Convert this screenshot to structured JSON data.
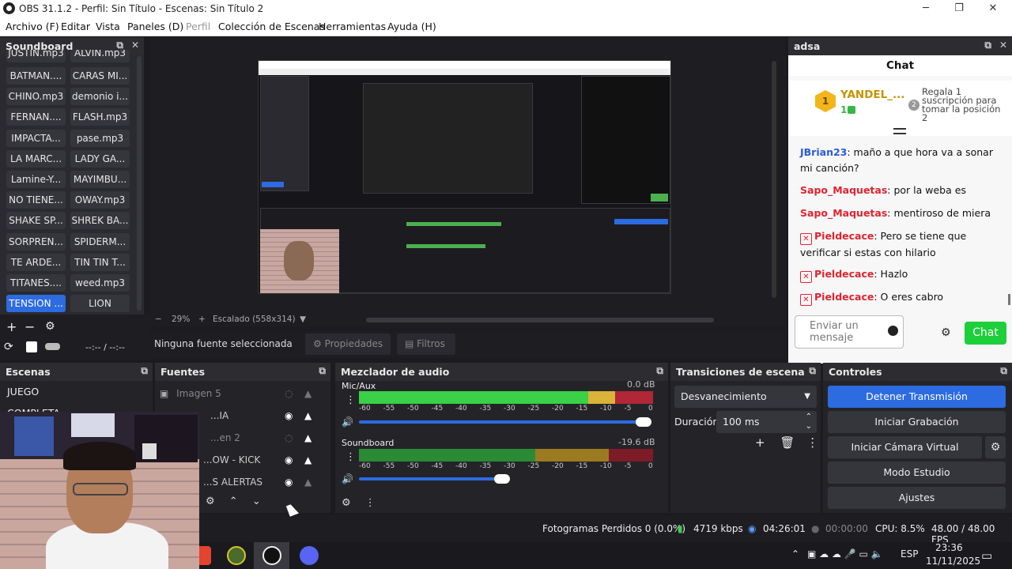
{
  "window": {
    "title": "OBS 31.1.2 - Perfil: Sin Título - Escenas: Sin Título 2",
    "min": "─",
    "max": "❐",
    "close": "✕"
  },
  "menu": {
    "items": [
      "Archivo (F)",
      "Editar",
      "Vista",
      "Paneles (D)",
      "Perfil",
      "Colección de Escenas",
      "Herramientas",
      "Ayuda (H)"
    ]
  },
  "soundboard": {
    "title": "Soundboard",
    "top_partial": [
      "JUSTIN.mp3",
      "ALVIN.mp3"
    ],
    "buttons": [
      [
        "BATMAN....",
        "CARAS MI..."
      ],
      [
        "CHINO.mp3",
        "demonio i..."
      ],
      [
        "FERNAN....",
        "FLASH.mp3"
      ],
      [
        "IMPACTA...",
        "pase.mp3"
      ],
      [
        "LA MARC...",
        "LADY GA..."
      ],
      [
        "Lamine-Y...",
        "MAYIMBU..."
      ],
      [
        "NO TIENE...",
        "OWAY.mp3"
      ],
      [
        "SHAKE SP...",
        "SHREK BA..."
      ],
      [
        "SORPREN...",
        "SPIDERM..."
      ],
      [
        "TE ARDE...",
        "TIN TIN T..."
      ],
      [
        "TITANES....",
        "weed.mp3"
      ],
      [
        "TENSION ...",
        "LION"
      ]
    ],
    "add": "+",
    "remove": "−",
    "settings": "⚙",
    "time": "--:-- / --:--"
  },
  "preview": {
    "zoom_minus": "−",
    "zoom": "29%",
    "zoom_plus": "+",
    "scale": "Escalado (558x314)",
    "dropdown": "▼"
  },
  "source_toolbar": {
    "no_source": "Ninguna fuente seleccionada",
    "properties": "Propiedades",
    "filters": "Filtros"
  },
  "chat": {
    "dock_title": "adsa",
    "header": "Chat",
    "pinned_user": "YANDEL_...",
    "pinned_rank": "1",
    "pinned_count": "1",
    "pinned_text": "Regala 1 suscripción para tomar la posición 2",
    "messages": [
      {
        "user": "JBrian23",
        "text": ": maño a que hora va a sonar mi canción?",
        "color": "blue"
      },
      {
        "user": "Sapo_Maquetas",
        "text": ": por la weba es",
        "color": "red"
      },
      {
        "user": "Sapo_Maquetas",
        "text": ": mentiroso de miera",
        "color": "red"
      },
      {
        "user": "Pieldecace",
        "text": ": Pero se tiene que verificar si estas con hilario",
        "color": "red",
        "badge": true
      },
      {
        "user": "Pieldecace",
        "text": ": Hazlo",
        "color": "red",
        "badge": true
      },
      {
        "user": "Pieldecace",
        "text": ": O eres cabro",
        "color": "red",
        "badge": true
      }
    ],
    "input_placeholder": "Enviar un mensaje",
    "send": "Chat"
  },
  "scenes": {
    "title": "Escenas",
    "items": [
      "JUEGO",
      "COMPLETA"
    ]
  },
  "sources": {
    "title": "Fuentes",
    "items": [
      "Imagen 5",
      "...IA",
      "...en 2",
      "...OW - KICK",
      "...S ALERTAS"
    ]
  },
  "mixer": {
    "title": "Mezclador de audio",
    "channels": [
      {
        "name": "Mic/Aux",
        "db": "0.0 dB",
        "level": 0.97,
        "volume": 1.0
      },
      {
        "name": "Soundboard",
        "db": "-19.6 dB",
        "level": 0.85,
        "volume": 0.49
      }
    ],
    "scale": [
      "-60",
      "-55",
      "-50",
      "-45",
      "-40",
      "-35",
      "-30",
      "-25",
      "-20",
      "-15",
      "-10",
      "-5",
      "0"
    ]
  },
  "transitions": {
    "title": "Transiciones de escena",
    "selected": "Desvanecimiento",
    "duration_label": "Duración",
    "duration": "100 ms"
  },
  "controls": {
    "title": "Controles",
    "buttons": [
      "Detener Transmisión",
      "Iniciar Grabación",
      "Iniciar Cámara Virtual",
      "Modo Estudio",
      "Ajustes"
    ]
  },
  "status": {
    "dropped": "Fotogramas Perdidos 0 (0.0%)",
    "bitrate": "4719 kbps",
    "stream_time": "04:26:01",
    "rec_time": "00:00:00",
    "cpu": "CPU: 8.5%",
    "fps": "48.00 / 48.00 FPS"
  },
  "taskbar": {
    "lang": "ESP",
    "time": "23:36",
    "date": "11/11/2025"
  },
  "colors": {
    "accent": "#2d6be0",
    "chat_send": "#1dcf3a",
    "user_blue": "#2a5bd7",
    "user_red": "#e0242f",
    "meter_green": "#3ad047",
    "meter_yellow": "#d9b33a",
    "meter_red": "#b02737"
  }
}
